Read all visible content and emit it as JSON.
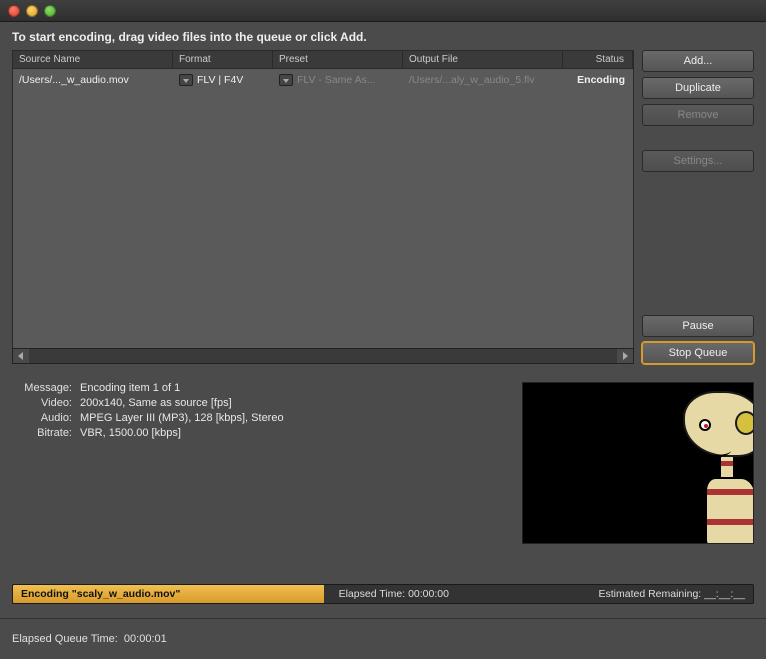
{
  "instruction": "To start encoding, drag video files into the queue or click Add.",
  "columns": {
    "source": "Source Name",
    "format": "Format",
    "preset": "Preset",
    "output": "Output File",
    "status": "Status"
  },
  "row": {
    "source": "/Users/..._w_audio.mov",
    "format": "FLV | F4V",
    "preset": "FLV - Same As...",
    "output": "/Users/...aly_w_audio_5.flv",
    "status": "Encoding"
  },
  "buttons": {
    "add": "Add...",
    "duplicate": "Duplicate",
    "remove": "Remove",
    "settings": "Settings...",
    "pause": "Pause",
    "stop": "Stop Queue"
  },
  "info": {
    "message_label": "Message:",
    "message": "Encoding item 1 of 1",
    "video_label": "Video:",
    "video": "200x140, Same as source [fps]",
    "audio_label": "Audio:",
    "audio": "MPEG Layer III (MP3), 128 [kbps], Stereo",
    "bitrate_label": "Bitrate:",
    "bitrate": "VBR, 1500.00 [kbps]"
  },
  "progress": {
    "encoding_label": "Encoding \"scaly_w_audio.mov\"",
    "elapsed_label": "Elapsed Time:",
    "elapsed": "00:00:00",
    "remaining_label": "Estimated Remaining:",
    "remaining": "__:__:__"
  },
  "footer": {
    "label": "Elapsed Queue Time:",
    "value": "00:00:01"
  }
}
